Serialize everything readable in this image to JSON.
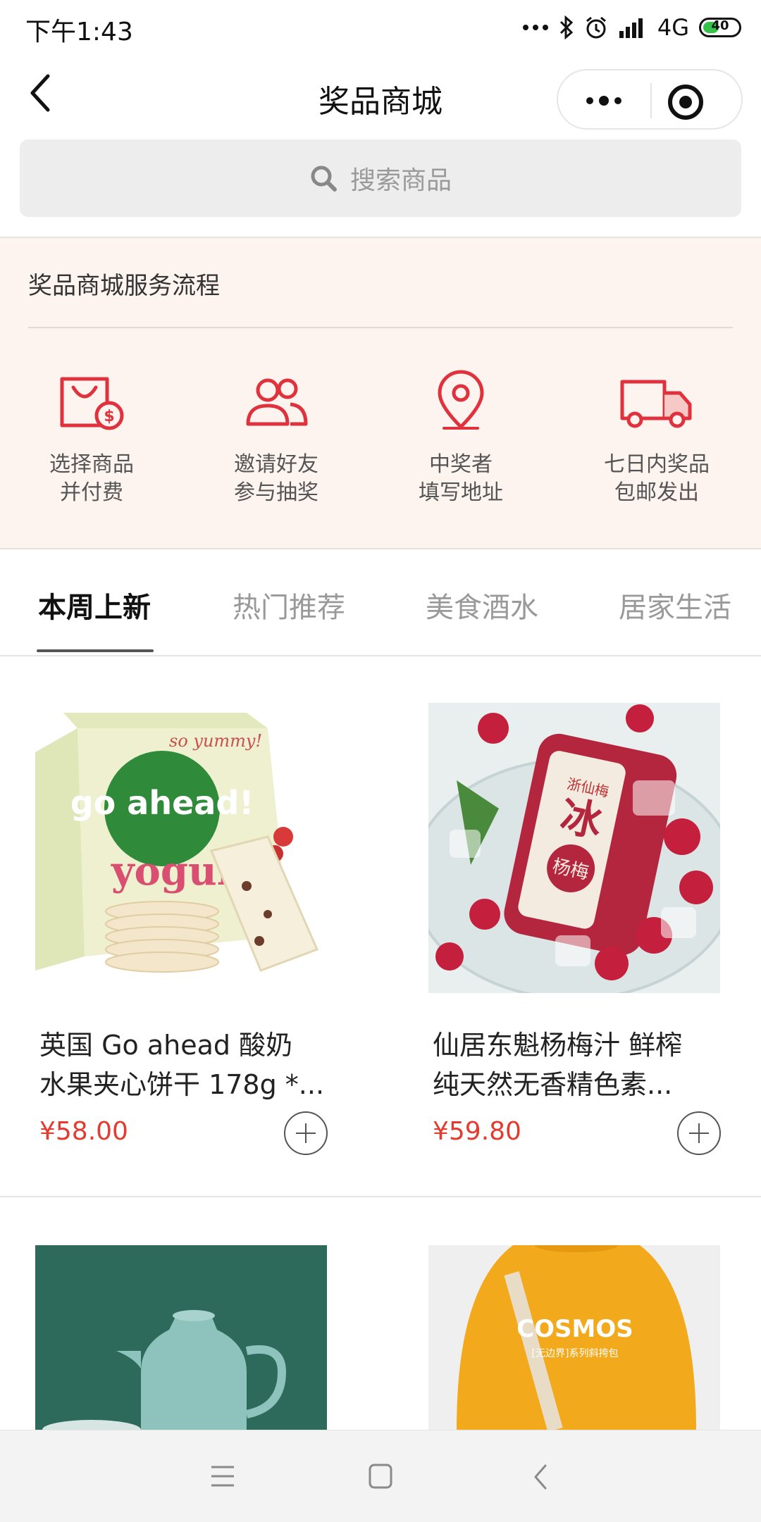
{
  "status_bar": {
    "time": "下午1:43",
    "network": "4G",
    "battery": "40"
  },
  "header": {
    "title": "奖品商城"
  },
  "search": {
    "placeholder": "搜索商品"
  },
  "service": {
    "title": "奖品商城服务流程",
    "steps": [
      {
        "line1": "选择商品",
        "line2": "并付费",
        "icon": "shopping-bag-icon"
      },
      {
        "line1": "邀请好友",
        "line2": "参与抽奖",
        "icon": "friends-icon"
      },
      {
        "line1": "中奖者",
        "line2": "填写地址",
        "icon": "location-pin-icon"
      },
      {
        "line1": "七日内奖品",
        "line2": "包邮发出",
        "icon": "delivery-truck-icon"
      }
    ]
  },
  "tabs": [
    {
      "label": "本周上新",
      "active": true
    },
    {
      "label": "热门推荐",
      "active": false
    },
    {
      "label": "美食酒水",
      "active": false
    },
    {
      "label": "居家生活",
      "active": false
    }
  ],
  "products": [
    {
      "name_line1": "英国 Go ahead 酸奶",
      "name_line2": "水果夹心饼干 178g *...",
      "price": "¥58.00"
    },
    {
      "name_line1": "仙居东魁杨梅汁 鲜榨",
      "name_line2": "纯天然无香精色素...",
      "price": "¥59.80"
    },
    {
      "image_text": "",
      "image": "teal-thermos-kettle"
    },
    {
      "image_text": "COSMOS",
      "image_subtext": "[无边界]系列斜挎包",
      "image": "yellow-sweatshirt-crossbody-bag"
    }
  ],
  "product_images": {
    "p1_brand": "go ahead!",
    "p1_flavor": "yogurt",
    "p1_banner": "so yummy!",
    "p2_label_top": "浙仙梅",
    "p2_label_main": "冰",
    "p2_label_sub": "杨梅"
  },
  "colors": {
    "accent_red": "#e33b2f",
    "flow_bg": "#fdf3ef",
    "icon_red": "#e0323d"
  }
}
